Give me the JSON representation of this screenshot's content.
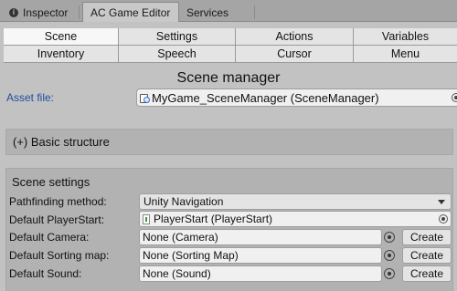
{
  "tabs": [
    {
      "label": "Inspector",
      "icon": "info-icon"
    },
    {
      "label": "AC Game Editor"
    },
    {
      "label": "Services"
    }
  ],
  "menu": {
    "row1": [
      "Scene",
      "Settings",
      "Actions",
      "Variables"
    ],
    "row2": [
      "Inventory",
      "Speech",
      "Cursor",
      "Menu"
    ]
  },
  "page_title": "Scene manager",
  "asset": {
    "label": "Asset file:",
    "value": "MyGame_SceneManager (SceneManager)"
  },
  "basic_structure": "(+) Basic structure",
  "scene_settings": {
    "title": "Scene settings",
    "pathfinding_label": "Pathfinding method:",
    "pathfinding_value": "Unity Navigation",
    "playerstart_label": "Default PlayerStart:",
    "playerstart_value": "PlayerStart (PlayerStart)",
    "camera_label": "Default Camera:",
    "camera_value": "None (Camera)",
    "sorting_label": "Default Sorting map:",
    "sorting_value": "None (Sorting Map)",
    "sound_label": "Default Sound:",
    "sound_value": "None (Sound)",
    "create_label": "Create"
  },
  "colors": {
    "background": "#c2c2c2",
    "selected_cell": "#f7f7f7",
    "asset_label": "#1f4fa1"
  }
}
